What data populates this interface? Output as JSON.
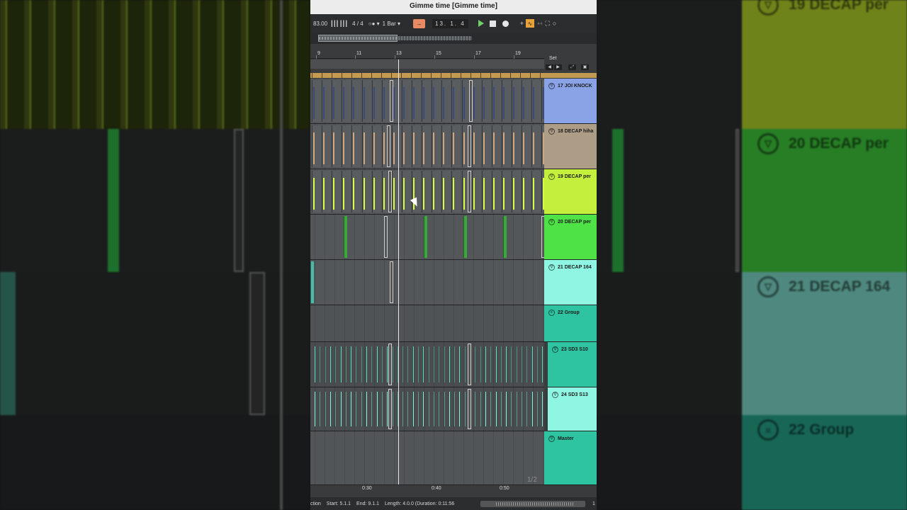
{
  "title": "Gimme time  [Gimme time]",
  "transport": {
    "tempo": "83.00",
    "signature": "4 / 4",
    "quantize": "1 Bar",
    "position": "13.  1.  4"
  },
  "ruler": {
    "bars": [
      "9",
      "11",
      "13",
      "15",
      "17",
      "19"
    ]
  },
  "set_panel": {
    "label": "Set"
  },
  "tracks": [
    {
      "name": "17 JOI KNOCK",
      "color": "#8aa3e6",
      "fold": "▽"
    },
    {
      "name": "18 DECAP hiha",
      "color": "#ad9c86",
      "fold": "▽"
    },
    {
      "name": "19 DECAP per",
      "color": "#c4ef3d",
      "fold": "▽"
    },
    {
      "name": "20 DECAP per",
      "color": "#4ee246",
      "fold": "▽"
    },
    {
      "name": "21 DECAP 164",
      "color": "#8ff6e3",
      "fold": "▽"
    },
    {
      "name": "22 Group",
      "color": "#2ec3a1",
      "fold": "≡"
    },
    {
      "name": "23 SD3 S10",
      "color": "#2ec3a1",
      "fold": "▽"
    },
    {
      "name": "24 SD3 S13",
      "color": "#8ff6e3",
      "fold": "▽"
    },
    {
      "name": "Master",
      "color": "#2ec3a1",
      "fold": "▽"
    }
  ],
  "page_indicator": "1/2",
  "time_ruler": [
    "0:30",
    "0:40",
    "0:50"
  ],
  "status": {
    "section": "ction",
    "start": "Start: 5.1.1",
    "end": "End: 9.1.1",
    "length": "Length: 4.0.0 (Duration: 0:11:56",
    "right": "1"
  },
  "background": {
    "labels": [
      "19 DECAP per",
      "20 DECAP per",
      "21 DECAP 164",
      "22 Group"
    ]
  }
}
